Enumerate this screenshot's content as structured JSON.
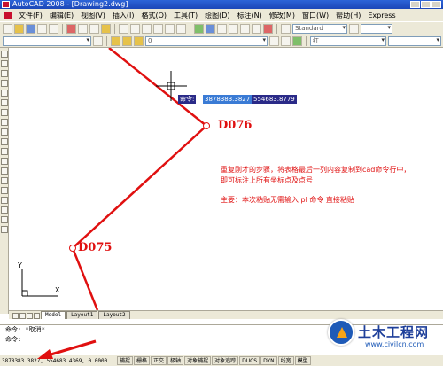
{
  "window": {
    "title": "AutoCAD 2008 - [Drawing2.dwg]"
  },
  "menu": [
    "文件(F)",
    "编辑(E)",
    "视图(V)",
    "插入(I)",
    "格式(O)",
    "工具(T)",
    "绘图(D)",
    "标注(N)",
    "修改(M)",
    "窗口(W)",
    "帮助(H)",
    "Express"
  ],
  "toolbar": {
    "style_value": "Standard",
    "layer_value": "0",
    "color_value": "红"
  },
  "canvas": {
    "tooltip": {
      "label": "命令:",
      "x": "3878383.3827",
      "y": "554683.8779"
    },
    "points": [
      {
        "label": "D076"
      },
      {
        "label": "D075"
      }
    ],
    "note": {
      "line1": "重复刚才的步骤，将表格最后一列内容复制到cad命令行中，",
      "line2": "即可标注上所有坐标点及点号",
      "line3": "主要：本次粘贴无需输入 pl 命令 直接粘贴"
    },
    "ucs": {
      "x_label": "X",
      "y_label": "Y"
    }
  },
  "tabs": [
    "Model",
    "Layout1",
    "Layout2"
  ],
  "command": {
    "line1": "命令: *取消*",
    "line2": "命令:"
  },
  "status": {
    "coords": "3878383.3827, 554683.4369, 0.0000",
    "buttons": [
      "捕捉",
      "栅格",
      "正交",
      "极轴",
      "对象捕捉",
      "对象追踪",
      "DUCS",
      "DYN",
      "线宽",
      "模型"
    ]
  },
  "watermark": {
    "title": "土木工程网",
    "url": "www.civilcn.com"
  },
  "colors": {
    "accent": "#e01010",
    "title_bar": "#2d64d8"
  }
}
